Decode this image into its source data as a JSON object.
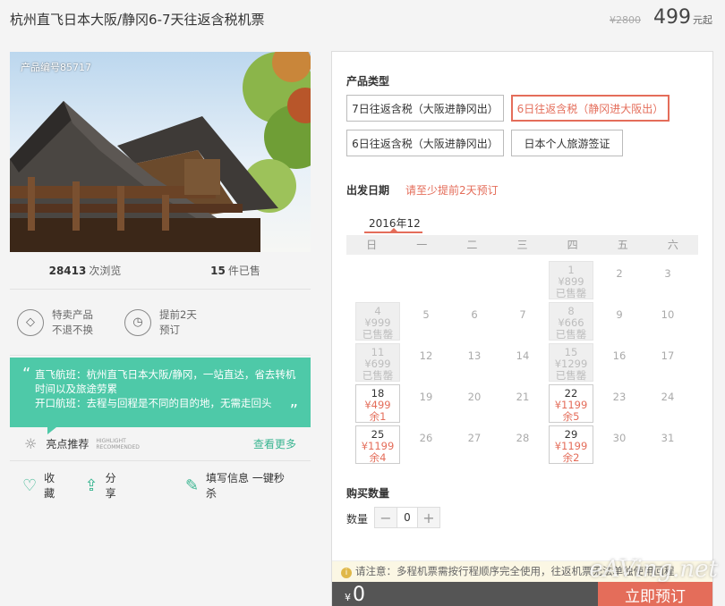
{
  "header": {
    "title": "杭州直飞日本大阪/静冈6-7天往返含税机票",
    "old_price": "¥2800",
    "price": "499",
    "price_unit": "元起"
  },
  "photo": {
    "code_label": "产品编号85717"
  },
  "stats": {
    "views_count": "28413",
    "views_label": "次浏览",
    "sold_count": "15",
    "sold_label": "件已售"
  },
  "features": [
    {
      "icon": "tag-icon",
      "line1": "特卖产品",
      "line2": "不退不换"
    },
    {
      "icon": "clock-icon",
      "line1": "提前2天",
      "line2": "预订"
    }
  ],
  "highlight": {
    "lines": [
      "直飞航班：杭州直飞日本大阪/静冈，一站直达，省去转机",
      "时间以及旅途劳累",
      "开口航班：去程与回程是不同的目的地，无需走回头"
    ],
    "section_label": "亮点推荐",
    "section_label_en_1": "HIGHLIGHT",
    "section_label_en_2": "RECOMMENDED",
    "more_label": "查看更多"
  },
  "actions": {
    "favorite": "收藏",
    "share": "分享",
    "fill_info": "填写信息 一键秒杀"
  },
  "booking": {
    "product_type_title": "产品类型",
    "options": [
      {
        "label": "7日往返含税（大阪进静冈出）",
        "selected": false
      },
      {
        "label": "6日往返含税（静冈进大阪出）",
        "selected": true
      },
      {
        "label": "6日往返含税（大阪进静冈出）",
        "selected": false
      },
      {
        "label": "日本个人旅游签证",
        "selected": false
      }
    ],
    "date_title": "出发日期",
    "date_hint": "请至少提前2天预订",
    "month": "2016年12",
    "weekdays": [
      "日",
      "一",
      "二",
      "三",
      "四",
      "五",
      "六"
    ],
    "quantity_title": "购买数量",
    "quantity_label": "数量",
    "quantity_value": "0",
    "minus": "−",
    "plus": "+"
  },
  "calendar": {
    "weeks": [
      [
        null,
        null,
        null,
        null,
        {
          "d": "1",
          "p": "¥899",
          "s": "已售罄",
          "st": "past"
        },
        {
          "d": "2",
          "st": "plain"
        },
        {
          "d": "3",
          "st": "plain"
        }
      ],
      [
        {
          "d": "4",
          "p": "¥999",
          "s": "已售罄",
          "st": "past"
        },
        {
          "d": "5",
          "st": "plain"
        },
        {
          "d": "6",
          "st": "plain"
        },
        {
          "d": "7",
          "st": "plain"
        },
        {
          "d": "8",
          "p": "¥666",
          "s": "已售罄",
          "st": "past"
        },
        {
          "d": "9",
          "st": "plain"
        },
        {
          "d": "10",
          "st": "plain"
        }
      ],
      [
        {
          "d": "11",
          "p": "¥699",
          "s": "已售罄",
          "st": "past"
        },
        {
          "d": "12",
          "st": "plain"
        },
        {
          "d": "13",
          "st": "plain"
        },
        {
          "d": "14",
          "st": "plain"
        },
        {
          "d": "15",
          "p": "¥1299",
          "s": "已售罄",
          "st": "past"
        },
        {
          "d": "16",
          "st": "plain"
        },
        {
          "d": "17",
          "st": "plain"
        }
      ],
      [
        {
          "d": "18",
          "p": "¥499",
          "s": "余1",
          "st": "avail"
        },
        {
          "d": "19",
          "st": "plain"
        },
        {
          "d": "20",
          "st": "plain"
        },
        {
          "d": "21",
          "st": "plain"
        },
        {
          "d": "22",
          "p": "¥1199",
          "s": "余5",
          "st": "avail"
        },
        {
          "d": "23",
          "st": "plain"
        },
        {
          "d": "24",
          "st": "plain"
        }
      ],
      [
        {
          "d": "25",
          "p": "¥1199",
          "s": "余4",
          "st": "avail"
        },
        {
          "d": "26",
          "st": "plain"
        },
        {
          "d": "27",
          "st": "plain"
        },
        {
          "d": "28",
          "st": "plain"
        },
        {
          "d": "29",
          "p": "¥1199",
          "s": "余2",
          "st": "avail"
        },
        {
          "d": "30",
          "st": "plain"
        },
        {
          "d": "31",
          "st": "plain"
        }
      ]
    ]
  },
  "footer": {
    "notice": "请注意：多程机票需按行程顺序完全使用，往返机票无法单独使用回程",
    "total_currency": "¥",
    "total": "0",
    "buy_label": "立即预订",
    "watermark": "eAVing.net"
  },
  "colors": {
    "accent": "#e46d5a",
    "green": "#4ec9a8",
    "link_green": "#3ab591"
  }
}
